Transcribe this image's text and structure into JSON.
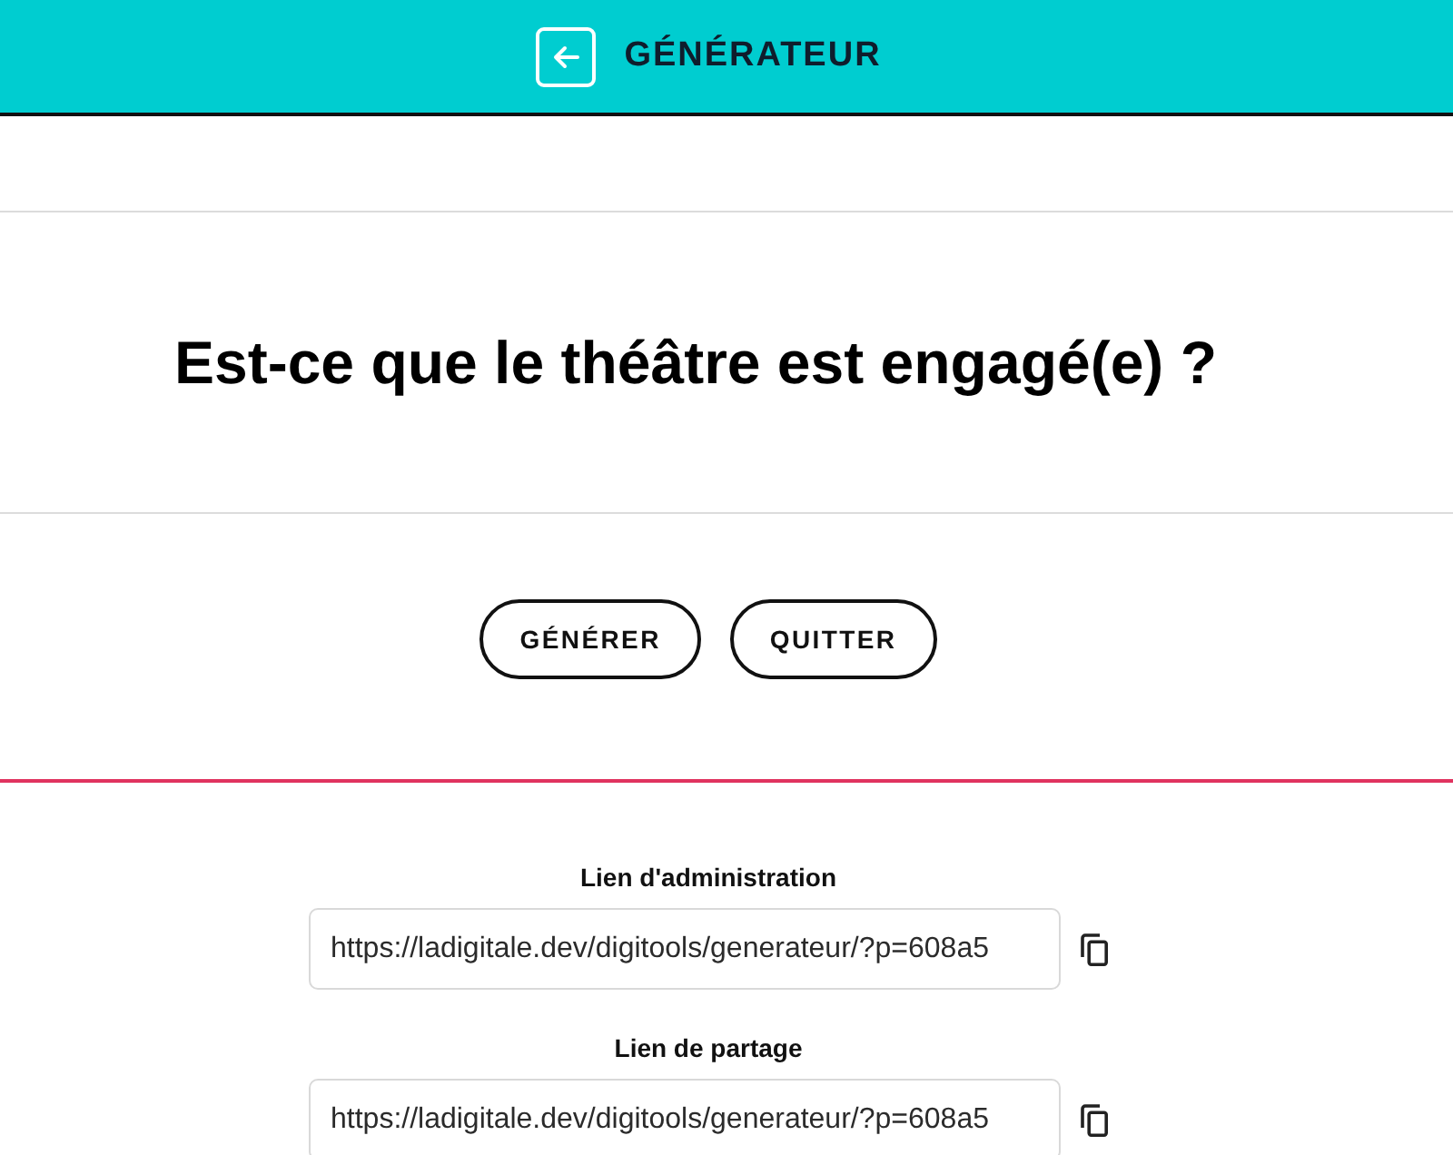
{
  "header": {
    "title": "GÉNÉRATEUR"
  },
  "question": {
    "text": "Est-ce que le théâtre est engagé(e) ?"
  },
  "buttons": [
    "GÉNÉRER",
    "QUITTER"
  ],
  "links": [
    {
      "label": "Lien d'administration",
      "value": "https://ladigitale.dev/digitools/generateur/?p=608a5"
    },
    {
      "label": "Lien de partage",
      "value": "https://ladigitale.dev/digitools/generateur/?p=608a5"
    }
  ]
}
